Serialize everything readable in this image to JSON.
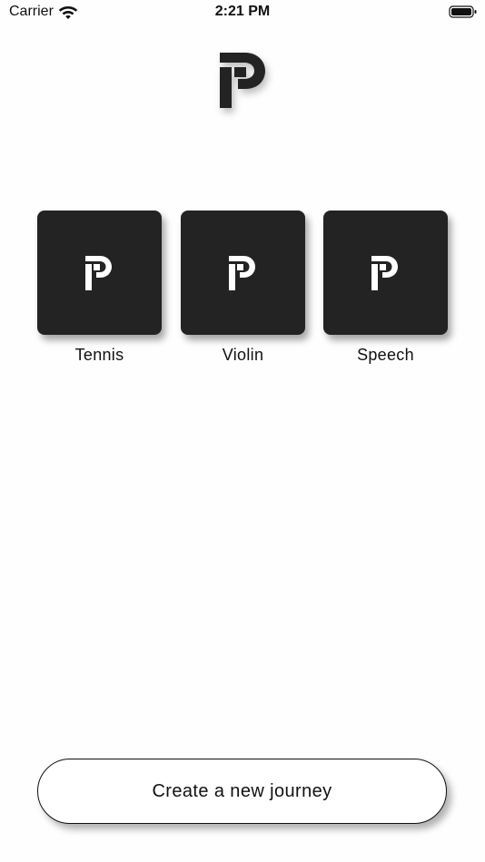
{
  "status_bar": {
    "carrier": "Carrier",
    "time": "2:21 PM",
    "wifi_icon": "wifi-icon",
    "battery_icon": "battery-full-icon"
  },
  "header": {
    "logo_icon": "p-logo-icon"
  },
  "journeys": [
    {
      "label": "Tennis",
      "icon": "p-logo-icon"
    },
    {
      "label": "Violin",
      "icon": "p-logo-icon"
    },
    {
      "label": "Speech",
      "icon": "p-logo-icon"
    }
  ],
  "actions": {
    "create_label": "Create a new journey"
  },
  "colors": {
    "background": "#fefefe",
    "tile": "#232323",
    "text": "#111111",
    "logo": "#232323"
  }
}
